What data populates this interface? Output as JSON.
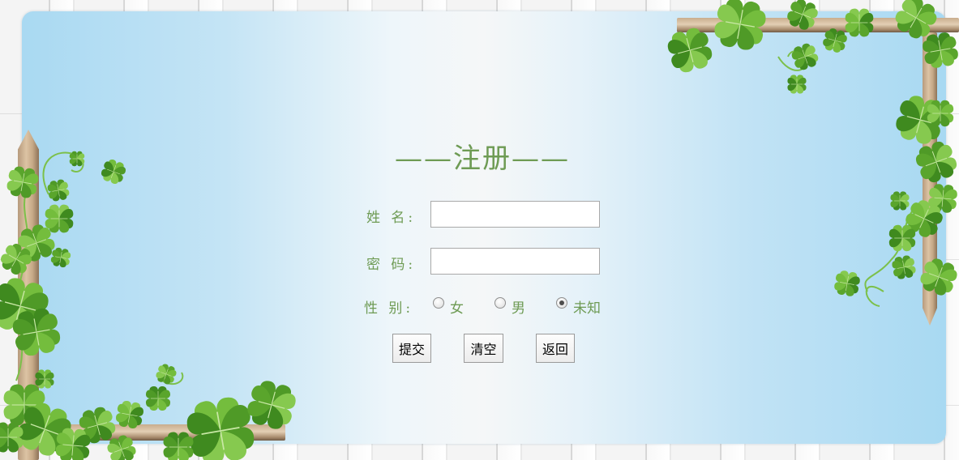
{
  "form": {
    "title": "——注册——",
    "name_label": "姓 名:",
    "name_value": "",
    "password_label": "密 码:",
    "password_value": "",
    "gender_label": "性 别:",
    "gender_options": [
      {
        "label": "女",
        "checked": false
      },
      {
        "label": "男",
        "checked": false
      },
      {
        "label": "未知",
        "checked": true
      }
    ],
    "buttons": {
      "submit": "提交",
      "clear": "清空",
      "back": "返回"
    }
  },
  "colors": {
    "label_green": "#6e9b54",
    "board_blue": "#a9d9f2",
    "clover_green": "#6cb23a"
  }
}
